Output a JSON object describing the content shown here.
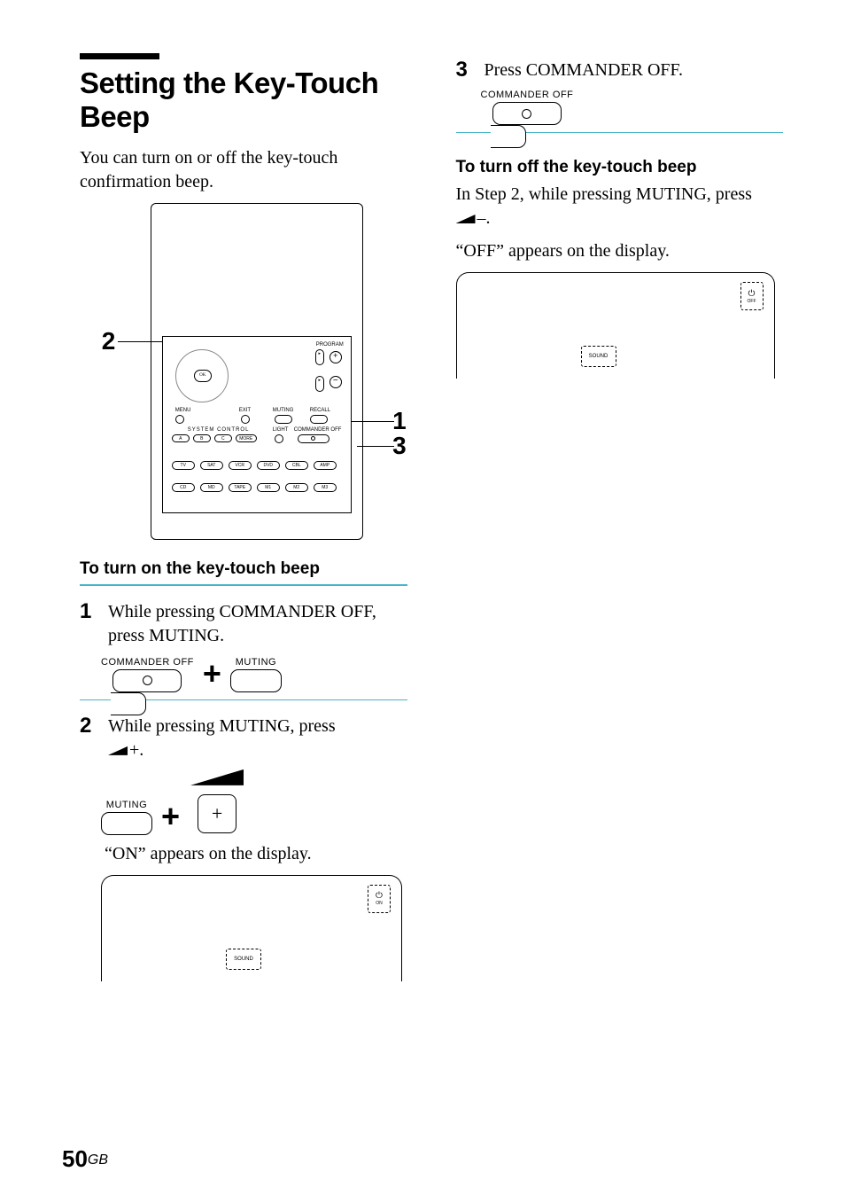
{
  "left": {
    "title": "Setting the Key-Touch Beep",
    "intro": "You can turn on or off the key-touch confirmation beep.",
    "diagram": {
      "callouts": {
        "c1": "1",
        "c2": "2",
        "c3": "3"
      },
      "labels": {
        "program": "PROGRAM",
        "menu": "MENU",
        "exit": "EXIT",
        "muting": "MUTING",
        "recall": "RECALL",
        "system": "SYSTEM CONTROL",
        "light": "LIGHT",
        "commander_off": "COMMANDER OFF",
        "ok": "OK"
      },
      "sysbtns": [
        "A",
        "B",
        "C",
        "MORE"
      ],
      "row1": [
        "TV",
        "SAT",
        "VCR",
        "DVD",
        "CBL",
        "AMP"
      ],
      "row2": [
        "CD",
        "MD",
        "TAPE",
        "M1",
        "M2",
        "M3"
      ]
    },
    "section_on": "To turn on the key-touch beep",
    "steps": {
      "s1": {
        "num": "1",
        "text": "While pressing COMMANDER OFF, press MUTING."
      },
      "s2": {
        "num": "2",
        "text1": "While pressing MUTING, press",
        "text2": "+.",
        "after": "“ON” appears on the display."
      }
    },
    "buttons": {
      "commander_off": "COMMANDER OFF",
      "muting": "MUTING"
    },
    "display_on": {
      "word": "ON",
      "sound": "SOUND"
    }
  },
  "right": {
    "step3": {
      "num": "3",
      "text": "Press COMMANDER OFF."
    },
    "button_commander_off": "COMMANDER OFF",
    "section_off": "To turn off the key-touch beep",
    "off_text1": "In Step 2, while pressing MUTING, press",
    "off_text2": "–.",
    "off_text3": "“OFF” appears on the display.",
    "display_off": {
      "word": "OFF",
      "sound": "SOUND"
    }
  },
  "page": {
    "num": "50",
    "suffix": "GB"
  }
}
